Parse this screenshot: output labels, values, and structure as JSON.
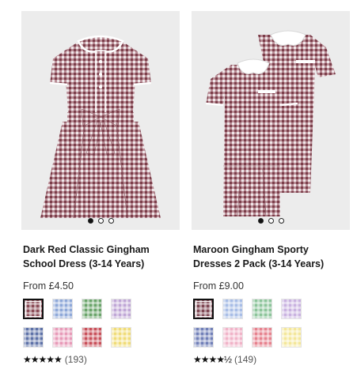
{
  "products": [
    {
      "title_line1": "Dark Red Classic Gingham",
      "title_line2": "School Dress (3-14 Years)",
      "price": "From £4.50",
      "rating_count": "(193)",
      "rating_stars": "★★★★★",
      "rating_value": 5,
      "carousel": {
        "total": 3,
        "active": 0
      },
      "swatches": [
        {
          "name": "dark-red",
          "color": "#8a4a55",
          "selected": true
        },
        {
          "name": "blue",
          "color": "#8ea8d8",
          "selected": false
        },
        {
          "name": "green",
          "color": "#6aa46a",
          "selected": false
        },
        {
          "name": "lilac",
          "color": "#bfa6d6",
          "selected": false
        },
        {
          "name": "navy",
          "color": "#5e72a8",
          "selected": false
        },
        {
          "name": "pink",
          "color": "#e79ab8",
          "selected": false
        },
        {
          "name": "red",
          "color": "#c8505a",
          "selected": false
        },
        {
          "name": "yellow",
          "color": "#f0dc78",
          "selected": false
        }
      ]
    },
    {
      "title_line1": "Maroon Gingham Sporty",
      "title_line2": "Dresses 2 Pack (3-14 Years)",
      "price": "From £9.00",
      "rating_count": "(149)",
      "rating_stars": "★★★★½",
      "rating_value": 4.5,
      "carousel": {
        "total": 3,
        "active": 0
      },
      "swatches": [
        {
          "name": "maroon",
          "color": "#7e4652",
          "selected": true
        },
        {
          "name": "blue",
          "color": "#a8bde6",
          "selected": false
        },
        {
          "name": "green",
          "color": "#8cc49a",
          "selected": false
        },
        {
          "name": "lilac",
          "color": "#c9b2e0",
          "selected": false
        },
        {
          "name": "navy",
          "color": "#7180b8",
          "selected": false
        },
        {
          "name": "pink",
          "color": "#f0b3c8",
          "selected": false
        },
        {
          "name": "red",
          "color": "#e6828e",
          "selected": false
        },
        {
          "name": "yellow",
          "color": "#f4e79a",
          "selected": false
        }
      ]
    }
  ]
}
